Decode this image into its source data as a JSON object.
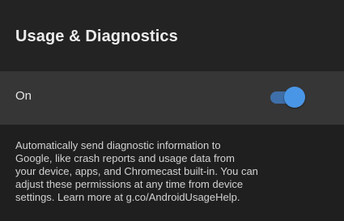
{
  "header": {
    "title": "Usage & Diagnostics"
  },
  "setting": {
    "label": "On",
    "toggle_state": "on",
    "toggle_color": "#4a96e6"
  },
  "description": {
    "lines": [
      "Automatically send diagnostic information to",
      "Google, like crash reports and usage data from",
      "your device, apps, and Chromecast built-in. You can",
      "adjust these permissions at any time from device",
      "settings. Learn more at g.co/AndroidUsageHelp."
    ]
  }
}
